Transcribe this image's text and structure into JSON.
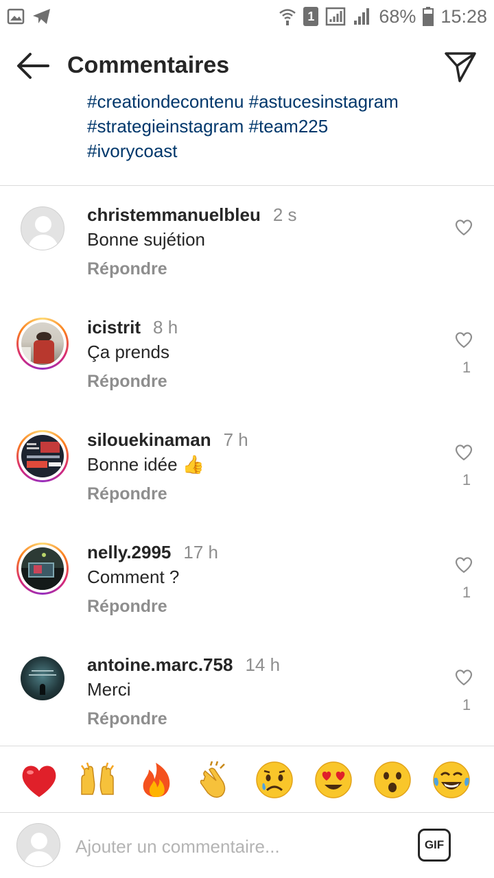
{
  "status_bar": {
    "signal_sim": "1",
    "battery": "68%",
    "time": "15:28"
  },
  "header": {
    "title": "Commentaires"
  },
  "caption": {
    "line1": "#creationdecontenu #astucesinstagram",
    "line2": "#strategieinstagram #team225",
    "line3": "#ivorycoast"
  },
  "comments": [
    {
      "username": "christemmanuelbleu",
      "time": "2 s",
      "text": "Bonne sujétion",
      "reply": "Répondre",
      "likes": ""
    },
    {
      "username": "icistrit",
      "time": "8 h",
      "text": "Ça prends",
      "reply": "Répondre",
      "likes": "1"
    },
    {
      "username": "silouekinaman",
      "time": "7 h",
      "text": "Bonne idée",
      "emoji": "👍",
      "reply": "Répondre",
      "likes": "1"
    },
    {
      "username": "nelly.2995",
      "time": "17 h",
      "text": "Comment ?",
      "reply": "Répondre",
      "likes": "1"
    },
    {
      "username": "antoine.marc.758",
      "time": "14 h",
      "text": "Merci",
      "reply": "Répondre",
      "likes": "1"
    }
  ],
  "quick_reactions": [
    "red-heart",
    "raising-hands",
    "fire",
    "clapping-hands",
    "sad-face",
    "heart-eyes",
    "surprised-face",
    "tears-of-joy"
  ],
  "input": {
    "placeholder": "Ajouter un commentaire...",
    "gif_label": "GIF"
  },
  "colors": {
    "hashtag": "#00376b",
    "secondary_text": "#8e8e8e",
    "primary_text": "#262626",
    "divider": "#dbdbdb"
  }
}
